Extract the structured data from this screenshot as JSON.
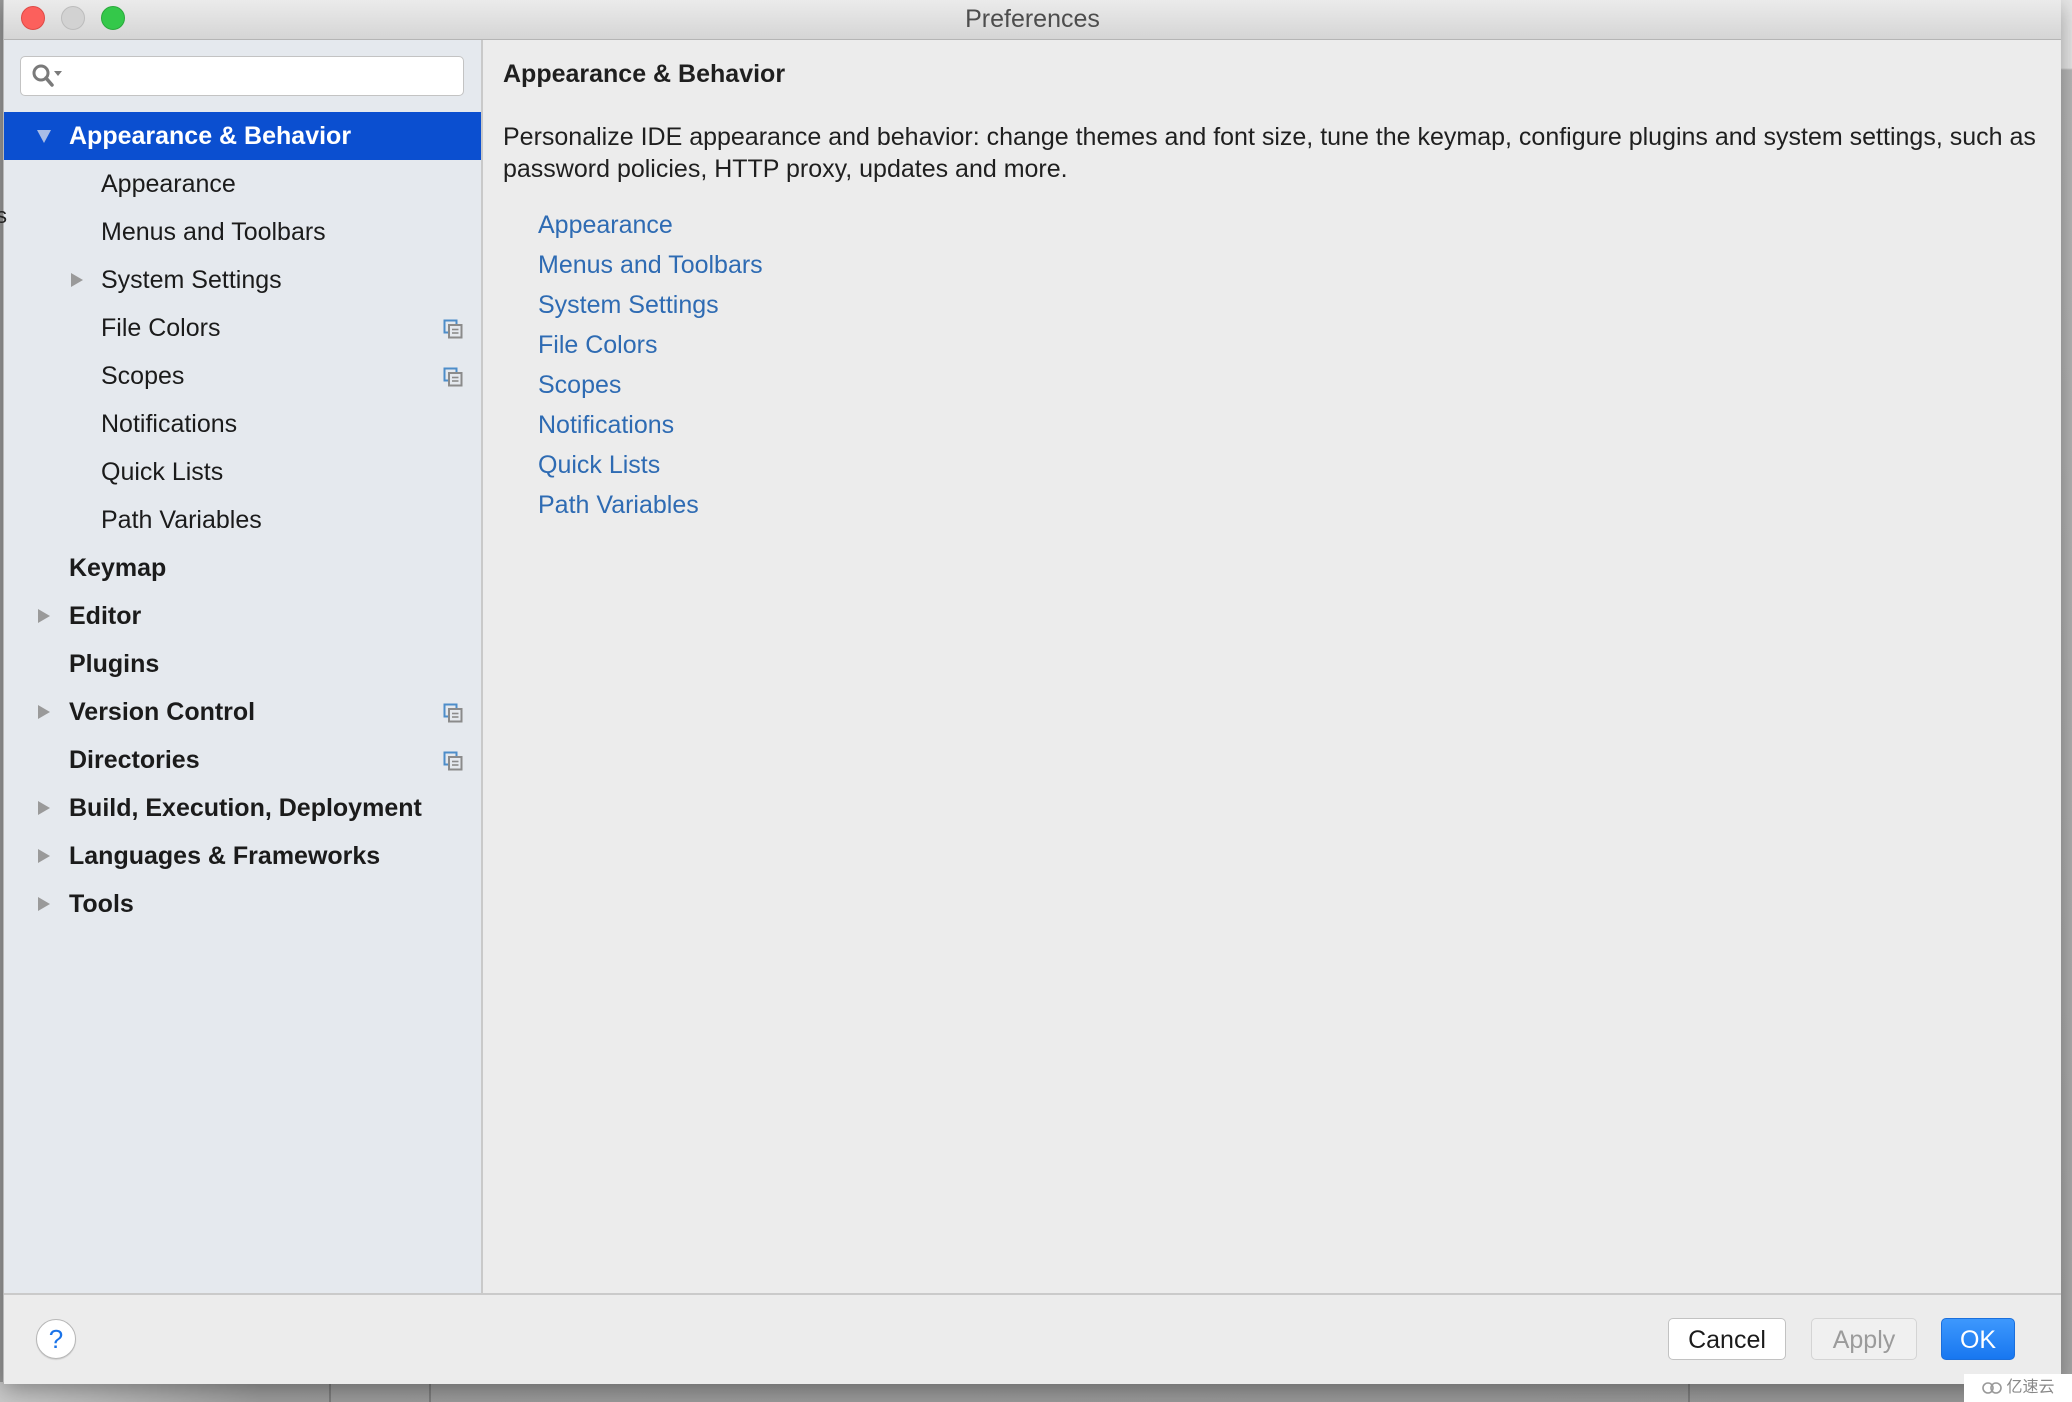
{
  "window": {
    "title": "Preferences"
  },
  "search": {
    "value": "",
    "placeholder": ""
  },
  "tree": {
    "items": [
      {
        "label": "Appearance & Behavior",
        "level": 0,
        "expandable": true,
        "expanded": true,
        "selected": true,
        "project_level": false
      },
      {
        "label": "Appearance",
        "level": 1,
        "expandable": false,
        "expanded": false,
        "selected": false,
        "project_level": false
      },
      {
        "label": "Menus and Toolbars",
        "level": 1,
        "expandable": false,
        "expanded": false,
        "selected": false,
        "project_level": false
      },
      {
        "label": "System Settings",
        "level": 1,
        "expandable": true,
        "expanded": false,
        "selected": false,
        "project_level": false
      },
      {
        "label": "File Colors",
        "level": 1,
        "expandable": false,
        "expanded": false,
        "selected": false,
        "project_level": true
      },
      {
        "label": "Scopes",
        "level": 1,
        "expandable": false,
        "expanded": false,
        "selected": false,
        "project_level": true
      },
      {
        "label": "Notifications",
        "level": 1,
        "expandable": false,
        "expanded": false,
        "selected": false,
        "project_level": false
      },
      {
        "label": "Quick Lists",
        "level": 1,
        "expandable": false,
        "expanded": false,
        "selected": false,
        "project_level": false
      },
      {
        "label": "Path Variables",
        "level": 1,
        "expandable": false,
        "expanded": false,
        "selected": false,
        "project_level": false
      },
      {
        "label": "Keymap",
        "level": 0,
        "expandable": false,
        "expanded": false,
        "selected": false,
        "project_level": false
      },
      {
        "label": "Editor",
        "level": 0,
        "expandable": true,
        "expanded": false,
        "selected": false,
        "project_level": false
      },
      {
        "label": "Plugins",
        "level": 0,
        "expandable": false,
        "expanded": false,
        "selected": false,
        "project_level": false
      },
      {
        "label": "Version Control",
        "level": 0,
        "expandable": true,
        "expanded": false,
        "selected": false,
        "project_level": true
      },
      {
        "label": "Directories",
        "level": 0,
        "expandable": false,
        "expanded": false,
        "selected": false,
        "project_level": true
      },
      {
        "label": "Build, Execution, Deployment",
        "level": 0,
        "expandable": true,
        "expanded": false,
        "selected": false,
        "project_level": false
      },
      {
        "label": "Languages & Frameworks",
        "level": 0,
        "expandable": true,
        "expanded": false,
        "selected": false,
        "project_level": false
      },
      {
        "label": "Tools",
        "level": 0,
        "expandable": true,
        "expanded": false,
        "selected": false,
        "project_level": false
      }
    ]
  },
  "content": {
    "title": "Appearance & Behavior",
    "description": "Personalize IDE appearance and behavior: change themes and font size, tune the keymap, configure plugins and system settings, such as password policies, HTTP proxy, updates and more.",
    "links": [
      "Appearance",
      "Menus and Toolbars",
      "System Settings",
      "File Colors",
      "Scopes",
      "Notifications",
      "Quick Lists",
      "Path Variables"
    ]
  },
  "footer": {
    "help_label": "?",
    "cancel_label": "Cancel",
    "apply_label": "Apply",
    "ok_label": "OK",
    "apply_enabled": false
  },
  "background": {
    "edge_fragment": "s",
    "watermark": "亿速云"
  },
  "colors": {
    "selection": "#0b4fd0",
    "link": "#2e6bb3",
    "primary_button": "#1877f0",
    "close": "#fc605c",
    "zoom": "#34c84a"
  }
}
